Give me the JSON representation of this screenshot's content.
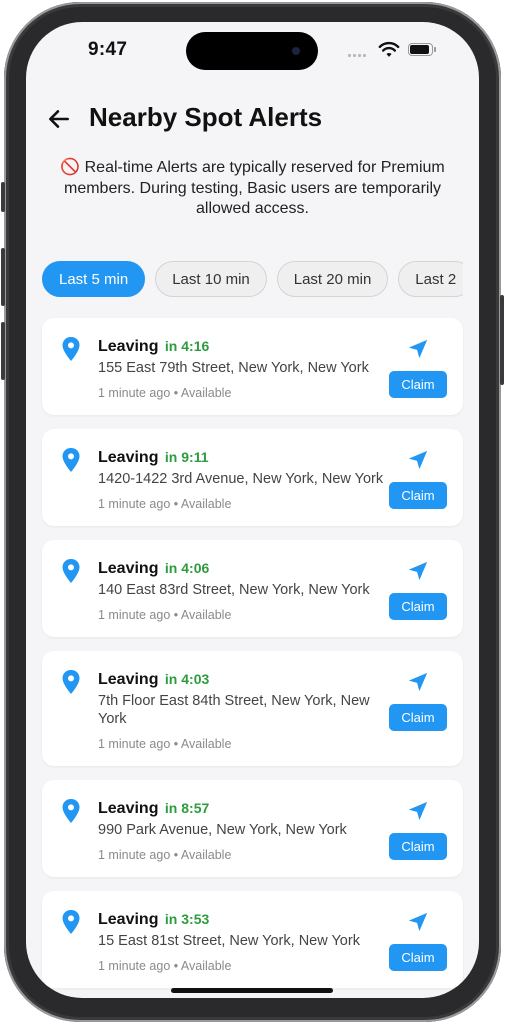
{
  "status": {
    "time": "9:47"
  },
  "header": {
    "title": "Nearby Spot Alerts"
  },
  "notice": "🚫 Real-time Alerts are typically reserved for Premium members. During testing, Basic users are temporarily allowed access.",
  "filters": [
    "Last 5 min",
    "Last 10 min",
    "Last 20 min",
    "Last 2"
  ],
  "active_filter": "Last 5 min",
  "colors": {
    "accent": "#2196f3",
    "eta_green": "#2e9c3e"
  },
  "alerts": [
    {
      "status": "Leaving",
      "eta": "in 4:16",
      "address": "155 East 79th Street, New York, New York",
      "meta": "1 minute ago • Available",
      "action": "Claim"
    },
    {
      "status": "Leaving",
      "eta": "in 9:11",
      "address": "1420-1422 3rd Avenue, New York, New York",
      "meta": "1 minute ago • Available",
      "action": "Claim"
    },
    {
      "status": "Leaving",
      "eta": "in 4:06",
      "address": "140 East 83rd Street, New York, New York",
      "meta": "1 minute ago • Available",
      "action": "Claim"
    },
    {
      "status": "Leaving",
      "eta": "in 4:03",
      "address": "7th Floor East 84th Street, New York, New York",
      "meta": "1 minute ago • Available",
      "action": "Claim"
    },
    {
      "status": "Leaving",
      "eta": "in 8:57",
      "address": "990 Park Avenue, New York, New York",
      "meta": "1 minute ago • Available",
      "action": "Claim"
    },
    {
      "status": "Leaving",
      "eta": "in 3:53",
      "address": "15 East 81st Street, New York, New York",
      "meta": "1 minute ago • Available",
      "action": "Claim"
    }
  ],
  "icons": {
    "back": "arrow-left-icon",
    "pin": "location-pin-icon",
    "navigate": "navigation-arrow-icon",
    "wifi": "wifi-icon",
    "battery": "battery-icon",
    "signal": "cellular-signal-icon"
  }
}
